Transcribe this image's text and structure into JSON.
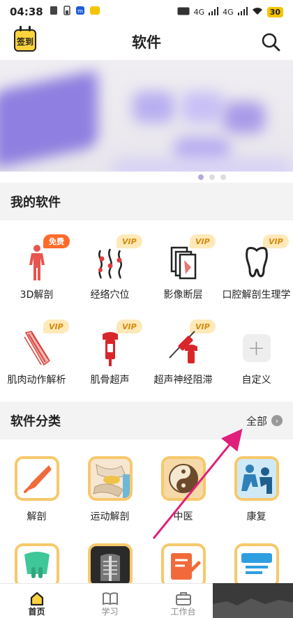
{
  "status_bar": {
    "time": "04:38",
    "network_1": "4G",
    "network_2": "4G",
    "battery": "30"
  },
  "header": {
    "checkin_label": "签到",
    "title": "软件"
  },
  "my_software": {
    "title": "我的软件",
    "items": [
      {
        "label": "3D解剖",
        "badge": "免费",
        "badge_type": "free",
        "icon": "human-body-icon"
      },
      {
        "label": "经络穴位",
        "badge": "VIP",
        "badge_type": "vip",
        "icon": "acupoint-icon"
      },
      {
        "label": "影像断层",
        "badge": "VIP",
        "badge_type": "vip",
        "icon": "imaging-slice-icon"
      },
      {
        "label": "口腔解剖生理学",
        "badge": "VIP",
        "badge_type": "vip",
        "icon": "tooth-icon"
      },
      {
        "label": "肌肉动作解析",
        "badge": "VIP",
        "badge_type": "vip",
        "icon": "muscle-icon"
      },
      {
        "label": "肌骨超声",
        "badge": "VIP",
        "badge_type": "vip",
        "icon": "ultrasound-probe-icon"
      },
      {
        "label": "超声神经阻滞",
        "badge": "VIP",
        "badge_type": "vip",
        "icon": "nerve-block-icon"
      },
      {
        "label": "自定义",
        "badge": "",
        "badge_type": "",
        "icon": "plus-icon"
      }
    ]
  },
  "categories": {
    "title": "软件分类",
    "more_label": "全部",
    "items": [
      {
        "label": "解剖",
        "icon": "scalpel-icon"
      },
      {
        "label": "运动解剖",
        "icon": "joint-icon"
      },
      {
        "label": "中医",
        "icon": "yin-yang-icon"
      },
      {
        "label": "康复",
        "icon": "rehab-icon"
      },
      {
        "label": "",
        "icon": "tooth-category-icon"
      },
      {
        "label": "",
        "icon": "xray-icon"
      },
      {
        "label": "",
        "icon": "notes-icon"
      },
      {
        "label": "",
        "icon": "text-icon"
      }
    ]
  },
  "tabbar": {
    "tabs": [
      {
        "label": "首页",
        "icon": "home-icon",
        "active": true
      },
      {
        "label": "学习",
        "icon": "book-icon",
        "active": false
      },
      {
        "label": "工作台",
        "icon": "briefcase-icon",
        "active": false
      }
    ]
  },
  "colors": {
    "accent": "#f7c86b",
    "vip_text": "#d58a10",
    "free_badge": "#ff6a2a",
    "annotation_arrow": "#e0207a"
  }
}
